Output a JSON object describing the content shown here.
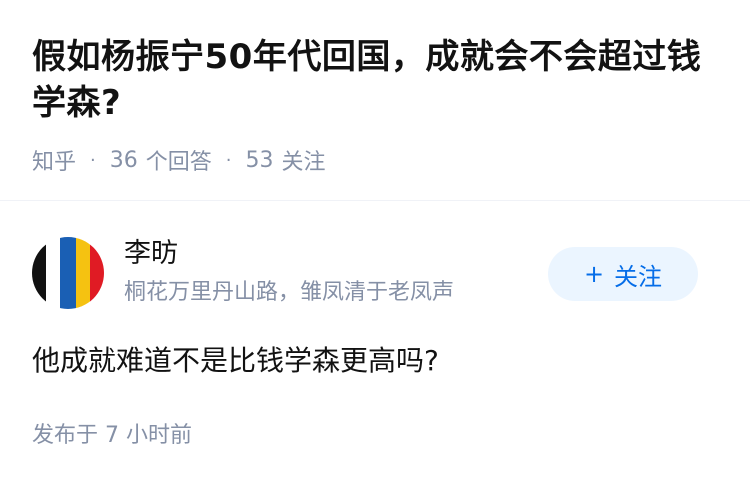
{
  "question": {
    "title": "假如杨振宁50年代回国，成就会不会超过钱学森?",
    "site": "知乎",
    "answers_count": "36",
    "answers_label": "个回答",
    "follows_count": "53",
    "follows_label": "关注",
    "separator": "·"
  },
  "answer": {
    "author_name": "李昉",
    "author_headline": "桐花万里丹山路，雏凤清于老凤声",
    "avatar_colors": [
      "#111111",
      "#ffffff",
      "#1a5fb4",
      "#f5c211",
      "#e01b24"
    ],
    "follow_button": {
      "plus": "+",
      "label": "关注"
    },
    "content": "他成就难道不是比钱学森更高吗?",
    "publish_time": "发布于 7 小时前"
  }
}
